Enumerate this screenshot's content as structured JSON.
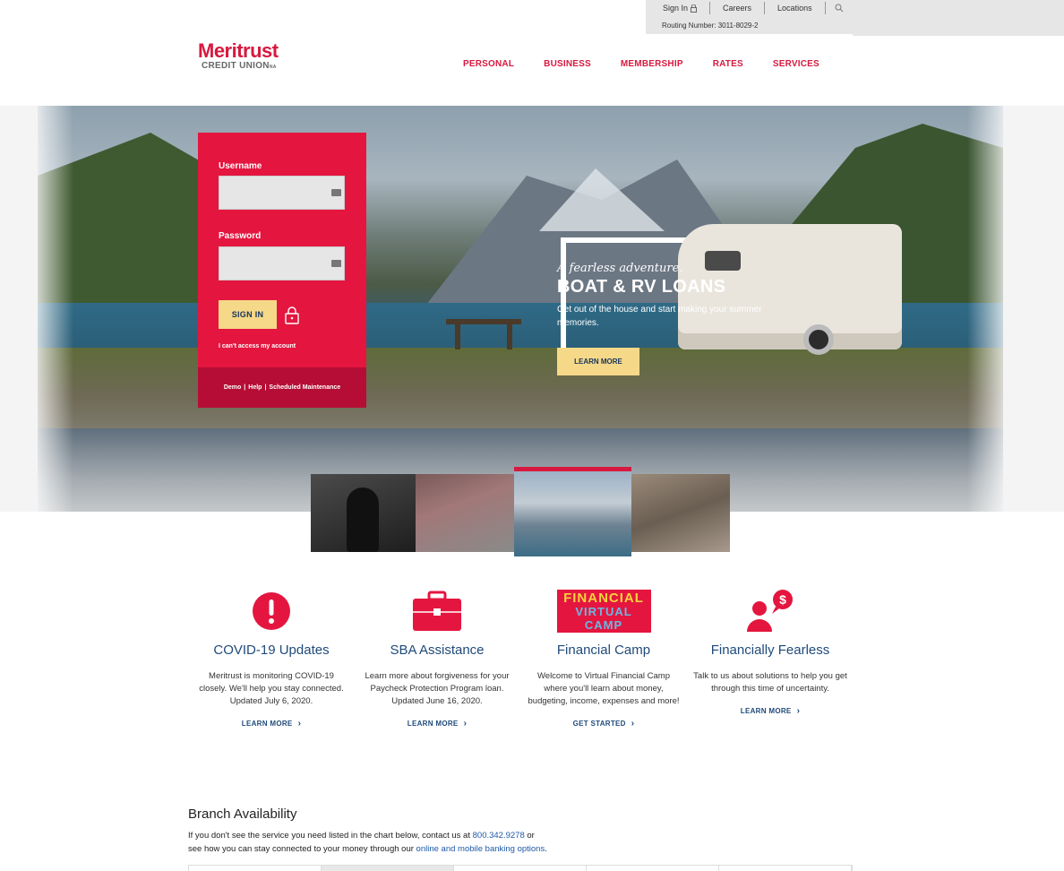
{
  "utility": {
    "sign_in": "Sign In",
    "careers": "Careers",
    "locations": "Locations",
    "routing": "Routing Number: 3011-8029-2"
  },
  "logo": {
    "line1": "Meritrust",
    "line2": "CREDIT UNION",
    "mark": "NA"
  },
  "nav": [
    "PERSONAL",
    "BUSINESS",
    "MEMBERSHIP",
    "RATES",
    "SERVICES"
  ],
  "login": {
    "username_label": "Username",
    "password_label": "Password",
    "signin_label": "SIGN IN",
    "cant_access": "I can't access my account",
    "footer": [
      "Demo",
      "Help",
      "Scheduled Maintenance"
    ]
  },
  "hero": {
    "kicker": "A fearless adventure.",
    "headline": "BOAT & RV LOANS",
    "sub": "Get out of the house and start making your summer memories.",
    "cta": "LEARN MORE"
  },
  "cards": [
    {
      "title": "COVID-19 Updates",
      "text": "Meritrust is monitoring COVID-19 closely. We'll help you stay connected. Updated July 6, 2020.",
      "link": "LEARN MORE",
      "icon": "alert-icon"
    },
    {
      "title": "SBA Assistance",
      "text": "Learn more about forgiveness for your Paycheck Protection Program loan. Updated June 16, 2020.",
      "link": "LEARN MORE",
      "icon": "briefcase-icon"
    },
    {
      "title": "Financial Camp",
      "text": "Welcome to Virtual Financial Camp where you'll learn about money, budgeting, income, expenses and more!",
      "link": "GET STARTED",
      "icon": "financial-camp-badge",
      "badge_top": "FINANCIAL",
      "badge_bottom": "VIRTUAL CAMP"
    },
    {
      "title": "Financially Fearless",
      "text": "Talk to us about solutions to help you get through this time of uncertainty.",
      "link": "LEARN MORE",
      "icon": "person-money-icon"
    }
  ],
  "branch": {
    "title": "Branch Availability",
    "line1_pre": "If you don't see the service you need listed in the chart below, contact us at ",
    "phone": "800.342.9278",
    "line1_post": " or",
    "line2_pre": "see how you can stay connected to your money through our ",
    "link": "online and mobile banking options",
    "line2_post": "."
  },
  "colors": {
    "brand_red": "#d7193f",
    "login_red": "#e4163f",
    "login_footer": "#b50d35",
    "cta_yellow": "#f6d889",
    "link_blue": "#1f4a7a"
  }
}
